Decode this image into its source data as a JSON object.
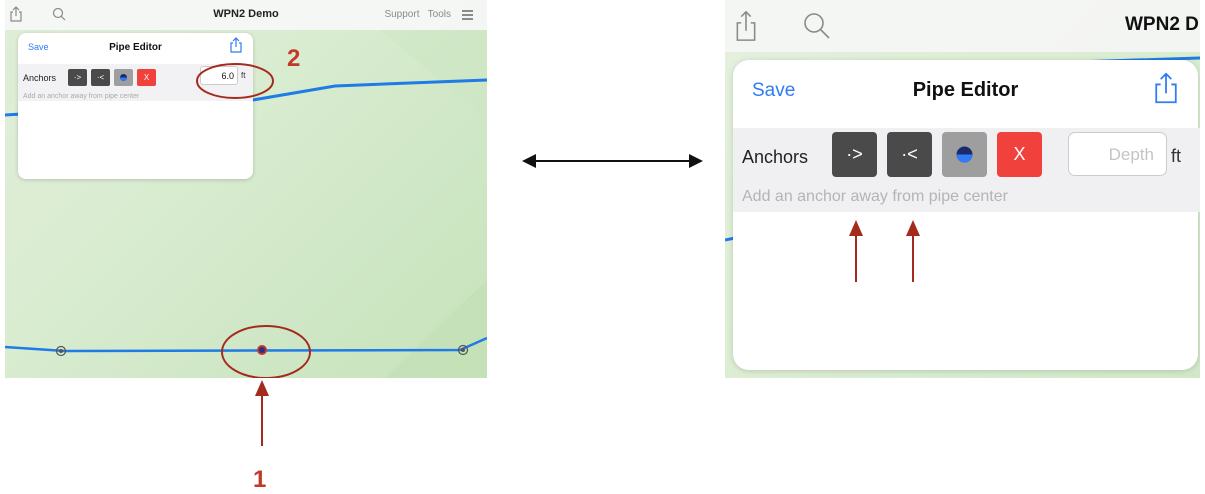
{
  "left_view": {
    "app_title": "WPN2 Demo",
    "menu": {
      "support": "Support",
      "tools": "Tools"
    },
    "panel": {
      "save": "Save",
      "title": "Pipe Editor",
      "anchors_label": "Anchors",
      "buttons": {
        "forward": "·>",
        "back": "·<",
        "center": "●",
        "delete": "X"
      },
      "depth_value": "6.0",
      "unit": "ft",
      "hint": "Add an anchor away from pipe center"
    }
  },
  "right_view": {
    "app_title": "WPN2 D",
    "panel": {
      "save": "Save",
      "title": "Pipe Editor",
      "anchors_label": "Anchors",
      "buttons": {
        "forward": "·>",
        "back": "·<",
        "center": "●",
        "delete": "X"
      },
      "depth_placeholder": "Depth",
      "unit": "ft",
      "hint": "Add an anchor away from pipe center"
    }
  },
  "annotations": {
    "label_1": "1",
    "label_2": "2"
  },
  "colors": {
    "pipe_blue": "#1f7be6",
    "accent_blue": "#2f7cf6",
    "delete_red": "#f0413c",
    "dark_button": "#4a4a4a",
    "gray_button": "#9e9e9e",
    "annotation_red": "#c0392b"
  },
  "icons": [
    "share-icon",
    "search-icon",
    "hamburger-icon",
    "anchor-dot-icon",
    "double-arrow",
    "annotation-arrow"
  ]
}
